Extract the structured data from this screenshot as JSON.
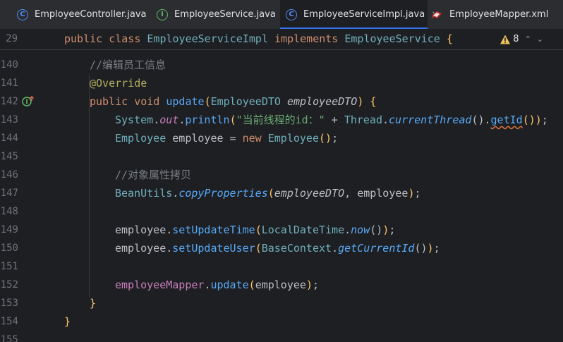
{
  "tabs": [
    {
      "label": "EmployeeController.java",
      "icon": "java-class-icon",
      "active": false
    },
    {
      "label": "EmployeeService.java",
      "icon": "java-interface-icon",
      "active": false
    },
    {
      "label": "EmployeeServiceImpl.java",
      "icon": "java-class-icon",
      "active": true,
      "close": "×"
    },
    {
      "label": "EmployeeMapper.xml",
      "icon": "xml-file-icon",
      "active": false
    }
  ],
  "sticky_line": {
    "number": "29"
  },
  "inspection": {
    "warning_count": "8",
    "up": "⌃",
    "down": "⌄"
  },
  "lines": {
    "l140": "140",
    "l141": "141",
    "l142": "142",
    "l143": "143",
    "l144": "144",
    "l145": "145",
    "l146": "146",
    "l147": "147",
    "l148": "148",
    "l149": "149",
    "l150": "150",
    "l151": "151",
    "l152": "152",
    "l153": "153",
    "l154": "154",
    "l155": "155"
  },
  "code": {
    "public": "public",
    "class": "class",
    "class_name": "EmployeeServiceImpl",
    "implements": "implements",
    "iface_name": "EmployeeService",
    "open_brace": "{",
    "close_brace": "}",
    "comment_edit": "//编辑员工信息",
    "override": "@Override",
    "void": "void",
    "update": "update",
    "dto_type": "EmployeeDTO",
    "dto_param": "employeeDTO",
    "system": "System",
    "out": "out",
    "println": "println",
    "string_literal": "\"当前线程的id：\"",
    "plus": "+",
    "thread": "Thread",
    "current_thread": "currentThread",
    "get_id": "getId",
    "employee_type": "Employee",
    "employee_var": "employee",
    "new": "new",
    "comment_copy": "//对象属性拷贝",
    "bean_utils": "BeanUtils",
    "copy_properties": "copyProperties",
    "set_update_time": "setUpdateTime",
    "local_date_time": "LocalDateTime",
    "now": "now",
    "set_update_user": "setUpdateUser",
    "base_context": "BaseContext",
    "get_current_id": "getCurrentId",
    "employee_mapper": "employeeMapper"
  },
  "colors": {
    "background": "#1e1f22",
    "keyword": "#cf8e6d",
    "method": "#56a8f5",
    "string": "#6aab73",
    "comment": "#7a7e85",
    "field": "#c77dbb",
    "annotation": "#b3ae60",
    "active_tab_accent": "#3574f0",
    "warning": "#f2c55c"
  }
}
